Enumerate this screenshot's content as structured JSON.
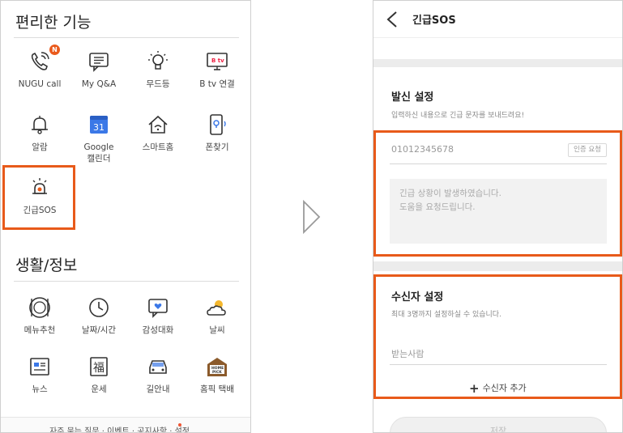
{
  "left": {
    "section1_title": "편리한 기능",
    "section2_title": "생활/정보",
    "badge": "N",
    "items": [
      {
        "label": "NUGU call",
        "icon": "phone-call-icon"
      },
      {
        "label": "My Q&A",
        "icon": "chat-list-icon"
      },
      {
        "label": "무드등",
        "icon": "lightbulb-icon"
      },
      {
        "label": "B tv 연결",
        "icon": "tv-icon"
      },
      {
        "label": "알람",
        "icon": "bell-icon"
      },
      {
        "label": "Google\n캘린더",
        "icon": "calendar-icon"
      },
      {
        "label": "스마트홈",
        "icon": "smart-home-icon"
      },
      {
        "label": "폰찾기",
        "icon": "phone-find-icon"
      },
      {
        "label": "긴급SOS",
        "icon": "siren-icon"
      }
    ],
    "items2": [
      {
        "label": "메뉴추천",
        "icon": "plate-icon"
      },
      {
        "label": "날짜/시간",
        "icon": "clock-icon"
      },
      {
        "label": "감성대화",
        "icon": "heart-chat-icon"
      },
      {
        "label": "날씨",
        "icon": "weather-icon"
      },
      {
        "label": "뉴스",
        "icon": "news-icon"
      },
      {
        "label": "운세",
        "icon": "fortune-icon"
      },
      {
        "label": "길안내",
        "icon": "car-icon"
      },
      {
        "label": "홈픽 택배",
        "icon": "homepick-icon"
      }
    ],
    "calendar_number": "31",
    "tv_badge": "B tv",
    "fortune_char": "福",
    "homepick_text": "HOME\nPICK",
    "footer_text": "자주 묻는 질문 · 이벤트 · 공지사항 · 설정"
  },
  "right": {
    "header_title": "긴급SOS",
    "send_title": "발신 설정",
    "send_desc": "입력하신 내용으로 긴급 문자를 보내드려요!",
    "phone_number": "01012345678",
    "verify_label": "인증 요청",
    "message": "긴급 상황이 발생하였습니다.\n도움을 요청드립니다.",
    "recipient_title": "수신자 설정",
    "recipient_desc": "최대 3명까지 설정하실 수 있습니다.",
    "recipient_placeholder": "받는사람",
    "add_recipient_label": "수신자 추가",
    "save_label": "저장"
  },
  "colors": {
    "highlight": "#e85a1a",
    "badge": "#ea5a1c",
    "calendar": "#3b78e7"
  }
}
